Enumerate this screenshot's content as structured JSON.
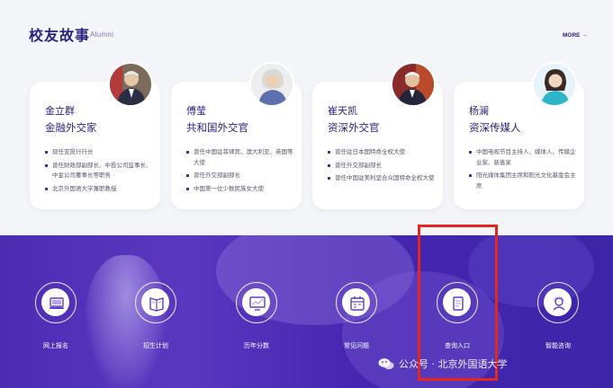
{
  "section": {
    "title": "校友故事",
    "subtitle": "Alumni",
    "more": "MORE →"
  },
  "cards": [
    {
      "name": "金立群",
      "role": "金融外交家",
      "points": [
        "现任亚投行行长",
        "曾任财政部副部长、中投公司监事长、中金公司董事长等职务",
        "北京外国语大学兼职教授"
      ]
    },
    {
      "name": "傅莹",
      "role": "共和国外交官",
      "points": [
        "曾任中国驻菲律宾、澳大利亚、英国等大使",
        "曾任外交部副部长",
        "中国第一位少数民族女大使"
      ]
    },
    {
      "name": "崔天凯",
      "role": "资深外交官",
      "points": [
        "曾任驻日本国特命全权大使",
        "曾任外交部副部长",
        "曾任中国驻美利坚合众国特命全权大使"
      ]
    },
    {
      "name": "杨澜",
      "role": "资深传媒人",
      "points": [
        "中国电视节目主持人、媒体人、传媒企业家、慈善家",
        "阳光媒体集团主席和阳光文化基金会主席"
      ]
    }
  ],
  "nav": [
    {
      "label": "网上报名",
      "icon": "computer-icon"
    },
    {
      "label": "招生计划",
      "icon": "book-icon"
    },
    {
      "label": "历年分数",
      "icon": "monitor-chart-icon"
    },
    {
      "label": "常见问题",
      "icon": "calendar-icon"
    },
    {
      "label": "查询入口",
      "icon": "scroll-icon"
    },
    {
      "label": "智能咨询",
      "icon": "agent-icon"
    }
  ],
  "watermark": "公众号 · 北京外国语大学",
  "colors": {
    "primary": "#2c2380",
    "banner": "#4b2db2",
    "highlight": "#e2271e"
  }
}
